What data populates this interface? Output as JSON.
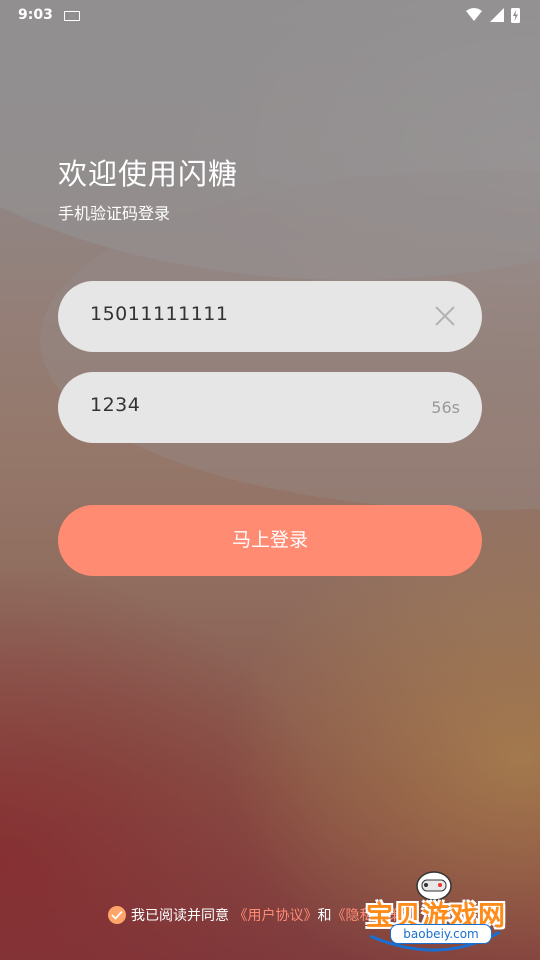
{
  "status_bar": {
    "time": "9:03",
    "icons": [
      "keyboard-icon",
      "wifi-icon",
      "signal-icon",
      "battery-charging-icon"
    ]
  },
  "header": {
    "title": "欢迎使用闪糖",
    "subtitle": "手机验证码登录"
  },
  "form": {
    "phone_value": "15011111111",
    "phone_clear_icon": "close-icon",
    "code_value": "1234",
    "countdown": "56s",
    "submit_label": "马上登录"
  },
  "agreement": {
    "checked": true,
    "prefix": "我已阅读并同意",
    "user_agreement": "《用户协议》",
    "conjunction": "和",
    "privacy_policy": "《隐私政策》"
  },
  "watermark": {
    "text": "宝贝游戏网",
    "url": "baobeiy.com"
  },
  "colors": {
    "accent": "#ff8b73",
    "field_bg": "#e6e6e6",
    "check": "#ffa56a"
  }
}
